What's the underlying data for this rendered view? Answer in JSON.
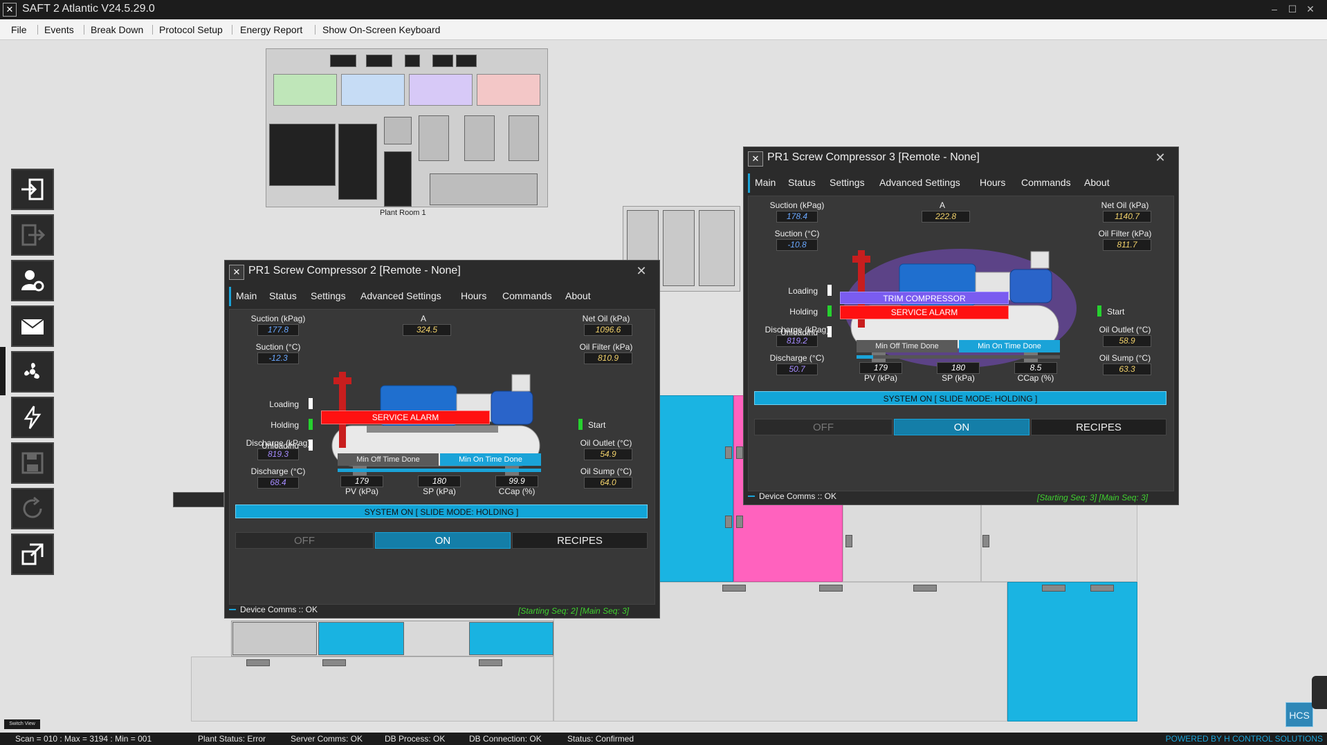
{
  "window": {
    "title": "SAFT 2 Atlantic V24.5.29.0",
    "logo_glyph": "✕",
    "controls": [
      "–",
      "☐",
      "✕"
    ]
  },
  "menu": [
    "File",
    "Events",
    "Break Down",
    "Protocol Setup",
    "Energy Report",
    "Show On-Screen Keyboard"
  ],
  "sidebar": [
    {
      "name": "login-icon"
    },
    {
      "name": "logout-icon"
    },
    {
      "name": "user-settings-icon"
    },
    {
      "name": "mail-icon"
    },
    {
      "name": "fan-icon"
    },
    {
      "name": "energy-icon"
    },
    {
      "name": "save-icon"
    },
    {
      "name": "refresh-icon"
    },
    {
      "name": "expand-icon"
    }
  ],
  "plant_room": {
    "label": "Plant Room 1"
  },
  "floor_labels": {
    "switch_view": "Switch View"
  },
  "dialog2": {
    "title": "PR1 Screw Compressor 2 [Remote - None]",
    "close": "✕",
    "tabs": [
      "Main",
      "Status",
      "Settings",
      "Advanced Settings",
      "Hours",
      "Commands",
      "About"
    ],
    "suction_kpag_label": "Suction (kPag)",
    "suction_kpag": "177.8",
    "suction_c_label": "Suction (°C)",
    "suction_c": "-12.3",
    "a_label": "A",
    "a_value": "324.5",
    "net_oil_label": "Net Oil (kPa)",
    "net_oil": "1096.6",
    "oil_filter_label": "Oil Filter (kPa)",
    "oil_filter": "810.9",
    "loading": "Loading",
    "holding": "Holding",
    "unloading": "Unloading",
    "start": "Start",
    "service_alarm": "SERVICE ALARM",
    "discharge_kpag_label": "Discharge (kPag)",
    "discharge_kpag": "819.3",
    "discharge_c_label": "Discharge (°C)",
    "discharge_c": "68.4",
    "min_off": "Min Off Time Done",
    "min_on": "Min On Time Done",
    "progress": 1.0,
    "pv": "179",
    "pv_label": "PV (kPa)",
    "sp": "180",
    "sp_label": "SP (kPa)",
    "ccap": "99.9",
    "ccap_label": "CCap (%)",
    "oil_outlet_label": "Oil Outlet (°C)",
    "oil_outlet": "54.9",
    "oil_sump_label": "Oil Sump (°C)",
    "oil_sump": "64.0",
    "system": "SYSTEM ON [ SLIDE MODE: HOLDING ]",
    "off": "OFF",
    "on": "ON",
    "recipes": "RECIPES",
    "comms": "Device Comms :: OK",
    "seq": "[Starting Seq: 2]  [Main Seq: 3]"
  },
  "dialog3": {
    "title": "PR1 Screw Compressor 3 [Remote - None]",
    "close": "✕",
    "tabs": [
      "Main",
      "Status",
      "Settings",
      "Advanced Settings",
      "Hours",
      "Commands",
      "About"
    ],
    "suction_kpag_label": "Suction (kPag)",
    "suction_kpag": "178.4",
    "suction_c_label": "Suction (°C)",
    "suction_c": "-10.8",
    "a_label": "A",
    "a_value": "222.8",
    "net_oil_label": "Net Oil (kPa)",
    "net_oil": "1140.7",
    "oil_filter_label": "Oil Filter (kPa)",
    "oil_filter": "811.7",
    "loading": "Loading",
    "holding": "Holding",
    "unloading": "Unloading",
    "start": "Start",
    "trim": "TRIM COMPRESSOR",
    "service_alarm": "SERVICE ALARM",
    "discharge_kpag_label": "Discharge (kPag)",
    "discharge_kpag": "819.2",
    "discharge_c_label": "Discharge (°C)",
    "discharge_c": "50.7",
    "min_off": "Min Off Time Done",
    "min_on": "Min On Time Done",
    "progress": 0.08,
    "pv": "179",
    "pv_label": "PV (kPa)",
    "sp": "180",
    "sp_label": "SP (kPa)",
    "ccap": "8.5",
    "ccap_label": "CCap (%)",
    "oil_outlet_label": "Oil Outlet (°C)",
    "oil_outlet": "58.9",
    "oil_sump_label": "Oil Sump (°C)",
    "oil_sump": "63.3",
    "system": "SYSTEM ON [ SLIDE MODE: HOLDING ]",
    "off": "OFF",
    "on": "ON",
    "recipes": "RECIPES",
    "comms": "Device Comms :: OK",
    "seq": "[Starting Seq: 3]  [Main Seq: 3]"
  },
  "status": {
    "scan": "Scan = 010 : Max = 3194 : Min = 001",
    "plant": "Plant Status: Error",
    "server": "Server Comms: OK",
    "db_process": "DB Process: OK",
    "db_connection": "DB Connection: OK",
    "status": "Status: Confirmed",
    "powered": "POWERED BY H CONTROL SOLUTIONS"
  },
  "hcs_logo": "HCS",
  "colors": {
    "accent": "#1aa3d8",
    "alarm": "#ff1111",
    "indicator_on": "#26d12f",
    "floor_cyan": "#1ab4e2",
    "floor_pink": "#ff62be"
  }
}
